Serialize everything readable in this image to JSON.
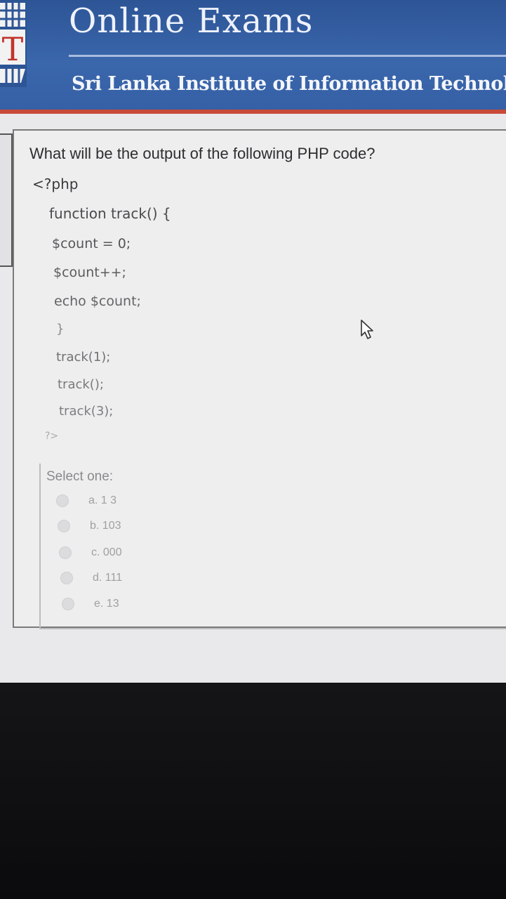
{
  "header": {
    "title": "Online Exams",
    "subtitle": "Sri Lanka Institute of Information Technology",
    "logo_letter": "T"
  },
  "question": {
    "text": "What will be the output of the following PHP code?",
    "code_lines": [
      "<?php",
      "function track() {",
      "$count = 0;",
      "$count++;",
      "echo $count;",
      "}",
      "track(1);",
      "track();",
      "track(3);",
      "?>"
    ]
  },
  "answers": {
    "prompt": "Select one:",
    "options": [
      {
        "label": "a. 1 3"
      },
      {
        "label": "b. 103"
      },
      {
        "label": "c. 000"
      },
      {
        "label": "d. 111"
      },
      {
        "label": "e. 13"
      }
    ]
  },
  "colors": {
    "header_bg": "#3560a6",
    "header_accent": "#c84a38",
    "page_bg": "#e9e9eb"
  },
  "icons": {
    "cursor": "arrow-cursor-icon"
  }
}
